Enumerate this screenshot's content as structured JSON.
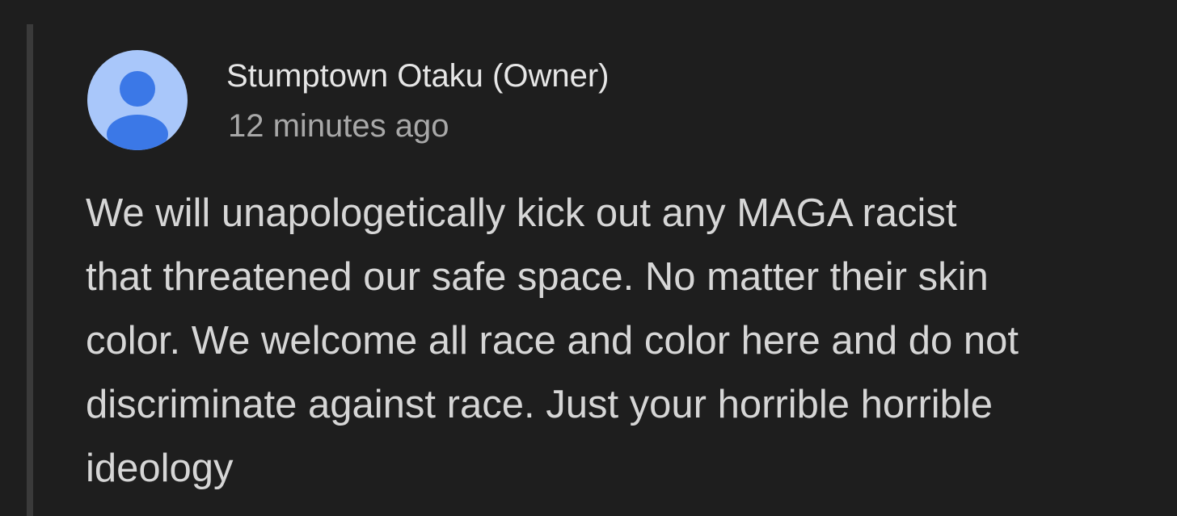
{
  "comment": {
    "author": "Stumptown Otaku (Owner)",
    "timestamp": "12 minutes ago",
    "text": "We will unapologetically kick out any MAGA racist\nthat threatened our safe space. No matter their skin\ncolor. We welcome all race and color here and do not\ndiscriminate against race. Just your horrible horrible\nideology",
    "avatar_icon": "person-icon"
  },
  "colors": {
    "background": "#1e1e1e",
    "avatar_bg": "#a9c7fa",
    "avatar_fg": "#3b78e7",
    "author_text": "#e6e6e6",
    "timestamp_text": "#a8a8a8",
    "body_text": "#d6d6d6"
  }
}
